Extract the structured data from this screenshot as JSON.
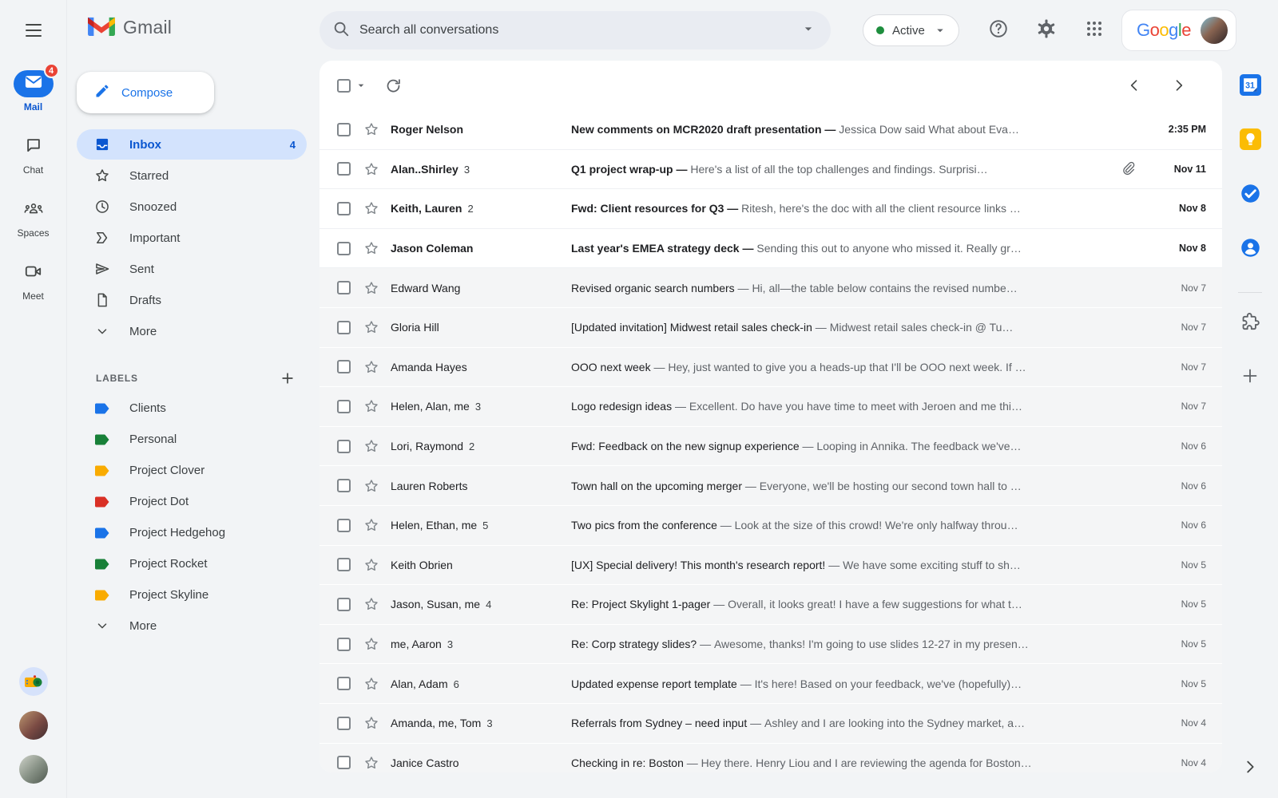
{
  "rail": {
    "items": [
      {
        "label": "Mail",
        "badge": "4",
        "active": true
      },
      {
        "label": "Chat"
      },
      {
        "label": "Spaces"
      },
      {
        "label": "Meet"
      }
    ]
  },
  "topbar": {
    "brand": "Gmail",
    "search_placeholder": "Search all conversations",
    "status_label": "Active",
    "google_wordmark": [
      {
        "ch": "G",
        "color": "#4285F4"
      },
      {
        "ch": "o",
        "color": "#EA4335"
      },
      {
        "ch": "o",
        "color": "#FBBC04"
      },
      {
        "ch": "g",
        "color": "#4285F4"
      },
      {
        "ch": "l",
        "color": "#34A853"
      },
      {
        "ch": "e",
        "color": "#EA4335"
      }
    ]
  },
  "drawer": {
    "compose_label": "Compose",
    "nav": [
      {
        "label": "Inbox",
        "count": "4",
        "active": true
      },
      {
        "label": "Starred"
      },
      {
        "label": "Snoozed"
      },
      {
        "label": "Important"
      },
      {
        "label": "Sent"
      },
      {
        "label": "Drafts"
      },
      {
        "label": "More"
      }
    ],
    "labels_header": "LABELS",
    "labels": [
      {
        "label": "Clients",
        "color": "#1a73e8"
      },
      {
        "label": "Personal",
        "color": "#188038"
      },
      {
        "label": "Project Clover",
        "color": "#f9ab00"
      },
      {
        "label": "Project Dot",
        "color": "#d93025"
      },
      {
        "label": "Project Hedgehog",
        "color": "#1a73e8"
      },
      {
        "label": "Project Rocket",
        "color": "#188038"
      },
      {
        "label": "Project Skyline",
        "color": "#f9ab00"
      }
    ],
    "labels_more": "More"
  },
  "list": {
    "separator": "—",
    "emails": [
      {
        "sender": "Roger Nelson",
        "subject": "New comments on MCR2020 draft presentation",
        "snippet": "Jessica Dow said What about Eva…",
        "date": "2:35 PM",
        "unread": true
      },
      {
        "sender": "Alan..Shirley",
        "count": "3",
        "subject": "Q1 project wrap-up",
        "snippet": "Here's a list of all the top challenges and findings. Surprisi…",
        "date": "Nov 11",
        "unread": true,
        "attachment": true
      },
      {
        "sender": "Keith, Lauren",
        "count": "2",
        "subject": "Fwd: Client resources for Q3",
        "snippet": "Ritesh, here's the doc with all the client resource links …",
        "date": "Nov 8",
        "unread": true
      },
      {
        "sender": "Jason Coleman",
        "subject": "Last year's EMEA strategy deck",
        "snippet": "Sending this out to anyone who missed it. Really gr…",
        "date": "Nov 8",
        "unread": true
      },
      {
        "sender": "Edward Wang",
        "subject": "Revised organic search numbers",
        "snippet": "Hi, all—the table below contains the revised numbe…",
        "date": "Nov 7"
      },
      {
        "sender": "Gloria Hill",
        "subject": "[Updated invitation] Midwest retail sales check-in",
        "snippet": "Midwest retail sales check-in @ Tu…",
        "date": "Nov 7"
      },
      {
        "sender": "Amanda Hayes",
        "subject": "OOO next week",
        "snippet": "Hey, just wanted to give you a heads-up that I'll be OOO next week. If …",
        "date": "Nov 7"
      },
      {
        "sender": "Helen, Alan, me",
        "count": "3",
        "subject": "Logo redesign ideas",
        "snippet": "Excellent. Do have you have time to meet with Jeroen and me thi…",
        "date": "Nov 7"
      },
      {
        "sender": "Lori, Raymond",
        "count": "2",
        "subject": "Fwd: Feedback on the new signup experience",
        "snippet": "Looping in Annika. The feedback we've…",
        "date": "Nov 6"
      },
      {
        "sender": "Lauren Roberts",
        "subject": "Town hall on the upcoming merger",
        "snippet": "Everyone, we'll be hosting our second town hall to …",
        "date": "Nov 6"
      },
      {
        "sender": "Helen, Ethan, me",
        "count": "5",
        "subject": "Two pics from the conference",
        "snippet": "Look at the size of this crowd! We're only halfway throu…",
        "date": "Nov 6"
      },
      {
        "sender": "Keith Obrien",
        "subject": "[UX] Special delivery! This month's research report!",
        "snippet": "We have some exciting stuff to sh…",
        "date": "Nov 5"
      },
      {
        "sender": "Jason, Susan, me",
        "count": "4",
        "subject": "Re: Project Skylight 1-pager",
        "snippet": "Overall, it looks great! I have a few suggestions for what t…",
        "date": "Nov 5"
      },
      {
        "sender": "me, Aaron",
        "count": "3",
        "subject": "Re: Corp strategy slides?",
        "snippet": "Awesome, thanks! I'm going to use slides 12-27 in my presen…",
        "date": "Nov 5"
      },
      {
        "sender": "Alan, Adam",
        "count": "6",
        "subject": "Updated expense report template",
        "snippet": "It's here! Based on your feedback, we've (hopefully)…",
        "date": "Nov 5"
      },
      {
        "sender": "Amanda, me, Tom",
        "count": "3",
        "subject": "Referrals from Sydney – need input",
        "snippet": "Ashley and I are looking into the Sydney market, a…",
        "date": "Nov 4"
      },
      {
        "sender": "Janice Castro",
        "subject": "Checking in re: Boston",
        "snippet": "Hey there. Henry Liou and I are reviewing the agenda for Boston…",
        "date": "Nov 4"
      }
    ]
  },
  "right_rail": {
    "calendar_day": "31"
  },
  "colors": {
    "accent_blue": "#0b57d0",
    "active_pill": "#d3e3fd",
    "badge_red": "#ea4335",
    "unread_text": "#202124",
    "muted_text": "#5f6368"
  }
}
